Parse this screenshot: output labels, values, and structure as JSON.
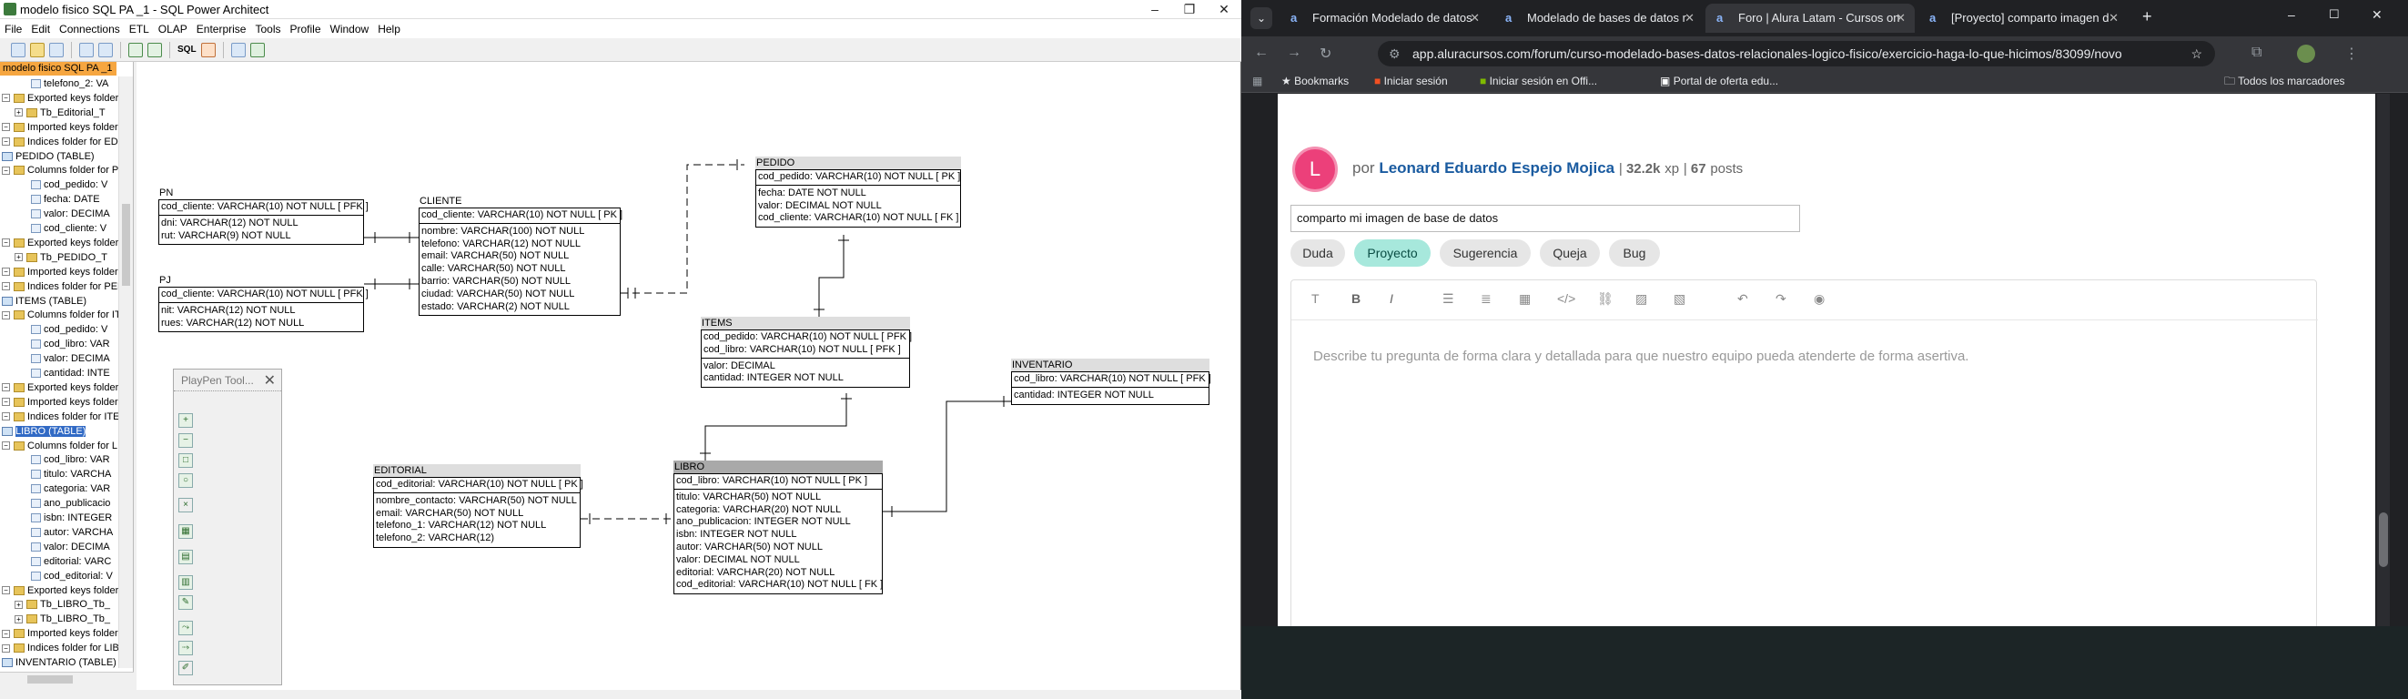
{
  "spa": {
    "title": "modelo fisico SQL PA _1 - SQL Power Architect",
    "menu": [
      "File",
      "Edit",
      "Connections",
      "ETL",
      "OLAP",
      "Enterprise",
      "Tools",
      "Profile",
      "Window",
      "Help"
    ],
    "toolbar_sql": "SQL",
    "tab_label": "modelo fisico SQL PA _1",
    "tree": [
      "telefono_2: VA",
      "Exported keys folder fo",
      "Tb_Editorial_T",
      "Imported keys folder fo",
      "Indices folder for EDITO",
      "PEDIDO (TABLE)",
      "Columns folder for PED",
      "cod_pedido: V",
      "fecha: DATE",
      "valor: DECIMA",
      "cod_cliente: V",
      "Exported keys folder fo",
      "Tb_PEDIDO_T",
      "Imported keys folder fo",
      "Indices folder for PEDI",
      "ITEMS (TABLE)",
      "Columns folder for ITEM",
      "cod_pedido: V",
      "cod_libro: VAR",
      "valor: DECIMA",
      "cantidad: INTE",
      "Exported keys folder fo",
      "Imported keys folder fo",
      "Indices folder for ITEM",
      "LIBRO (TABLE)",
      "Columns folder for LIBR",
      "cod_libro: VAR",
      "titulo: VARCHA",
      "categoria: VAR",
      "ano_publicacio",
      "isbn: INTEGER",
      "autor: VARCHA",
      "valor: DECIMA",
      "editorial: VARC",
      "cod_editorial: V",
      "Exported keys folder fo",
      "Tb_LIBRO_Tb_",
      "Tb_LIBRO_Tb_",
      "Imported keys folder fo",
      "Indices folder for LIBR",
      "INVENTARIO (TABLE)"
    ],
    "palette_title": "PlayPen Tool...",
    "tables": {
      "pn": {
        "name": "PN",
        "pk": [
          "cod_cliente: VARCHAR(10)  NOT NULL  [ PFK ]"
        ],
        "cols": [
          "dni: VARCHAR(12)  NOT NULL",
          "rut: VARCHAR(9)  NOT NULL"
        ]
      },
      "pj": {
        "name": "PJ",
        "pk": [
          "cod_cliente: VARCHAR(10)  NOT NULL  [ PFK ]"
        ],
        "cols": [
          "nit: VARCHAR(12)  NOT NULL",
          "rues: VARCHAR(12)  NOT NULL"
        ]
      },
      "cliente": {
        "name": "CLIENTE",
        "pk": [
          "cod_cliente: VARCHAR(10)  NOT NULL  [ PK ]"
        ],
        "cols": [
          "nombre: VARCHAR(100)  NOT NULL",
          "telefono: VARCHAR(12)  NOT NULL",
          "email: VARCHAR(50)  NOT NULL",
          "calle: VARCHAR(50)  NOT NULL",
          "barrio: VARCHAR(50)  NOT NULL",
          "ciudad: VARCHAR(50)  NOT NULL",
          "estado: VARCHAR(2)  NOT NULL"
        ]
      },
      "pedido": {
        "name": "PEDIDO",
        "pk": [
          "cod_pedido: VARCHAR(10)  NOT NULL  [ PK ]"
        ],
        "cols": [
          "fecha: DATE  NOT NULL",
          "valor: DECIMAL  NOT NULL",
          "cod_cliente: VARCHAR(10)  NOT NULL  [ FK ]"
        ]
      },
      "items": {
        "name": "ITEMS",
        "pk": [
          "cod_pedido: VARCHAR(10)  NOT NULL  [ PFK ]",
          "cod_libro: VARCHAR(10)  NOT NULL  [ PFK ]"
        ],
        "cols": [
          "valor: DECIMAL",
          "cantidad: INTEGER  NOT NULL"
        ]
      },
      "inventario": {
        "name": "INVENTARIO",
        "pk": [
          "cod_libro: VARCHAR(10)  NOT NULL  [ PFK ]"
        ],
        "cols": [
          "cantidad: INTEGER  NOT NULL"
        ]
      },
      "editorial": {
        "name": "EDITORIAL",
        "pk": [
          "cod_editorial: VARCHAR(10)  NOT NULL  [ PK ]"
        ],
        "cols": [
          "nombre_contacto: VARCHAR(50)  NOT NULL",
          "email: VARCHAR(50)  NOT NULL",
          "telefono_1: VARCHAR(12)  NOT NULL",
          "telefono_2: VARCHAR(12)"
        ]
      },
      "libro": {
        "name": "LIBRO",
        "pk": [
          "cod_libro: VARCHAR(10)  NOT NULL  [ PK ]"
        ],
        "cols": [
          "titulo: VARCHAR(50)  NOT NULL",
          "categoria: VARCHAR(20)  NOT NULL",
          "ano_publicacion: INTEGER  NOT NULL",
          "isbn: INTEGER  NOT NULL",
          "autor: VARCHAR(50)  NOT NULL",
          "valor: DECIMAL  NOT NULL",
          "editorial: VARCHAR(20)  NOT NULL",
          "cod_editorial: VARCHAR(10)  NOT NULL  [ FK ]"
        ]
      }
    }
  },
  "browser": {
    "tabs": [
      "Formación Modelado de datos",
      "Modelado de bases de datos r",
      "Foro | Alura Latam - Cursos on",
      "[Proyecto] comparto imagen d"
    ],
    "url": "app.aluracursos.com/forum/curso-modelado-bases-datos-relacionales-logico-fisico/exercicio-haga-lo-que-hicimos/83099/novo",
    "bookmarks": [
      "Bookmarks",
      "Iniciar sesión",
      "Iniciar sesión en Offi...",
      "Portal de oferta edu...",
      "Todos los marcadores"
    ]
  },
  "post": {
    "avatar_letter": "L",
    "by": "por",
    "author": "Leonard Eduardo Espejo Mojica",
    "xp": "32.2k",
    "xp_label": "xp",
    "posts": "67",
    "posts_label": "posts",
    "title_value": "comparto mi imagen de base de datos",
    "categories": [
      "Duda",
      "Proyecto",
      "Sugerencia",
      "Queja",
      "Bug"
    ],
    "active_category": "Proyecto",
    "editor_placeholder": "Describe tu pregunta de forma clara y detallada para que nuestro equipo pueda atenderte de forma asertiva."
  }
}
